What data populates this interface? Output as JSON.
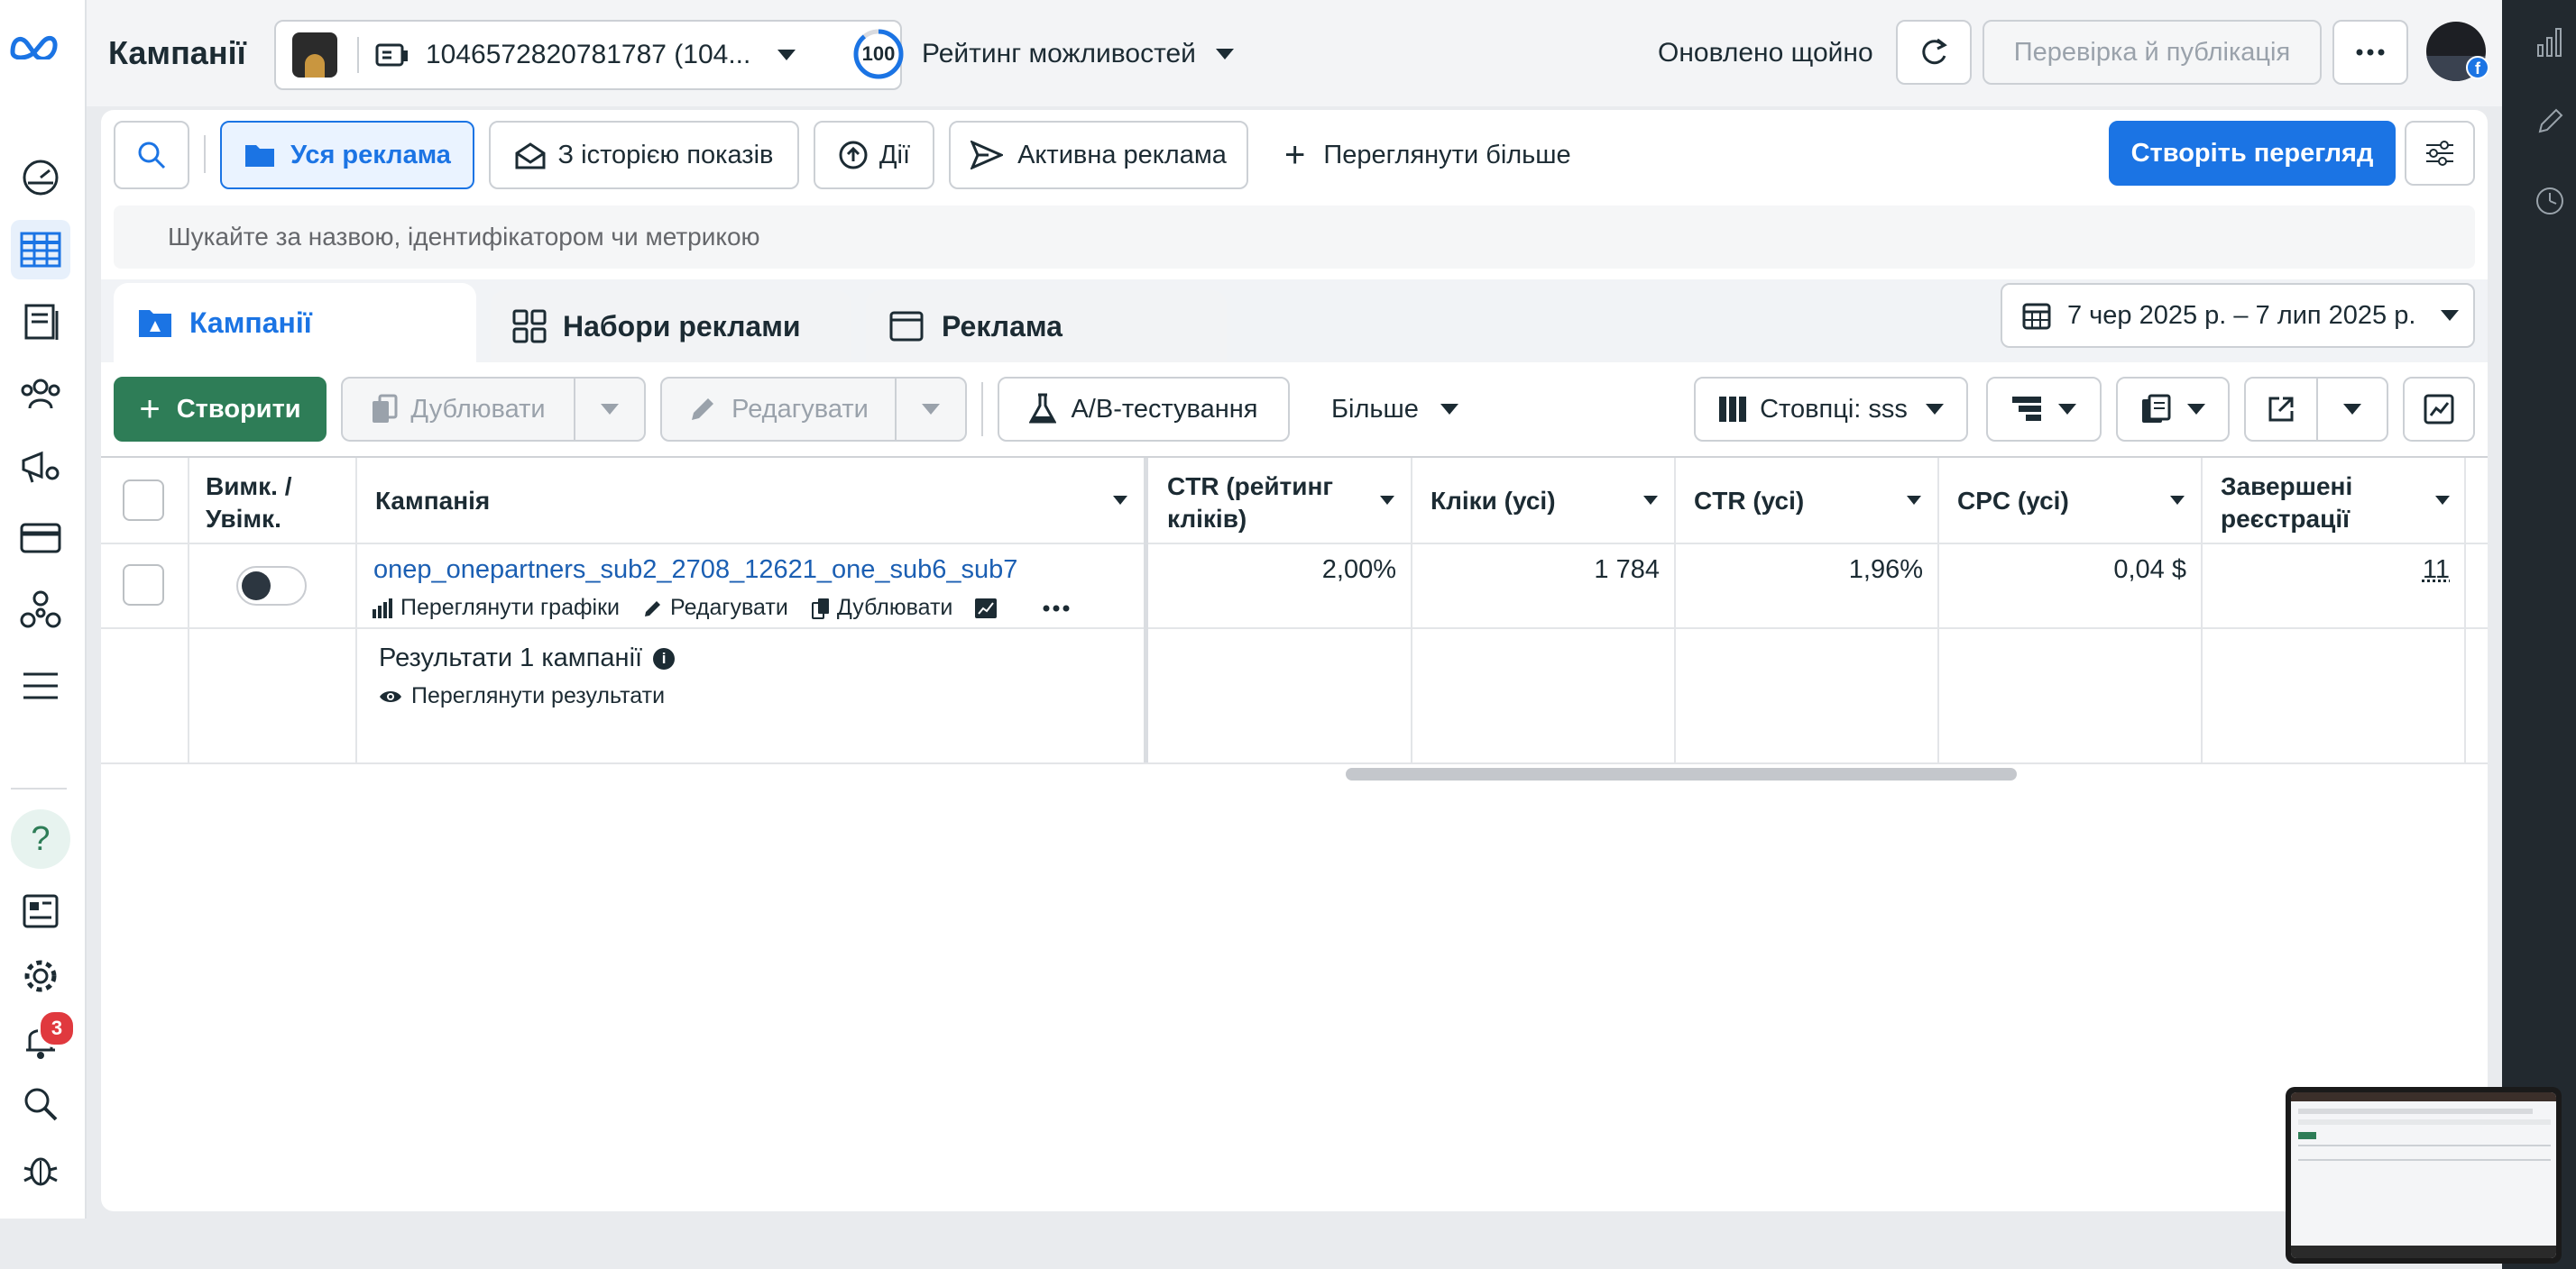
{
  "header": {
    "title": "Кампанії",
    "account_label": "1046572820781787 (104...",
    "score_value": "100",
    "score_label": "Рейтинг можливостей",
    "updated_text": "Оновлено щойно",
    "review_publish_label": "Перевірка й публікація"
  },
  "filters": {
    "all_ads": "Уся реклама",
    "with_history": "З історією показів",
    "actions": "Дії",
    "active_ads": "Активна реклама",
    "see_more": "Переглянути більше",
    "create_view": "Створіть перегляд"
  },
  "search": {
    "placeholder": "Шукайте за назвою, ідентифікатором чи метрикою"
  },
  "tabs": [
    {
      "label": "Кампанії"
    },
    {
      "label": "Набори реклами"
    },
    {
      "label": "Реклама"
    }
  ],
  "date_range": "7 чер 2025 р. – 7 лип 2025 р.",
  "toolbar": {
    "create": "Створити",
    "duplicate": "Дублювати",
    "edit": "Редагувати",
    "ab_test": "A/B-тестування",
    "more": "Більше",
    "columns": "Стовпці: sss"
  },
  "table": {
    "headers": {
      "toggle": "Вимк. / Увімк.",
      "campaign": "Кампанія",
      "ctr_link": "CTR (рейтинг кліків)",
      "clicks_all": "Кліки (усі)",
      "ctr_all": "CTR (усі)",
      "cpc_all": "CPC (усі)",
      "registrations": "Завершені реєстрації"
    },
    "rows": [
      {
        "campaign": "onep_onepartners_sub2_2708_12621_one_sub6_sub7",
        "actions": {
          "charts": "Переглянути графіки",
          "edit": "Редагувати",
          "duplicate": "Дублювати"
        },
        "ctr_link": "2,00%",
        "clicks_all": "1 784",
        "ctr_all": "1,96%",
        "cpc_all": "0,04 $",
        "registrations": "11"
      }
    ],
    "summary": {
      "title": "Результати 1 кампанії",
      "view_results": "Переглянути результати"
    }
  },
  "notifications_count": "3",
  "colors": {
    "accent": "#1b74e4",
    "create_green": "#2e7d57",
    "badge_red": "#e0393e",
    "link": "#1b5fb3"
  }
}
